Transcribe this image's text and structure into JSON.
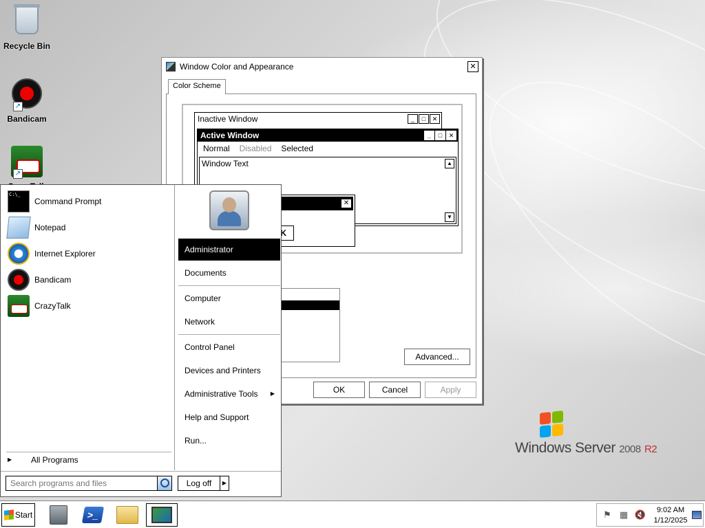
{
  "desktop": {
    "icons": [
      {
        "label": "Recycle Bin",
        "icon": "recycle-bin-icon"
      },
      {
        "label": "Bandicam",
        "icon": "bandicam-icon"
      },
      {
        "label": "CrazyTalk",
        "icon": "crazytalk-icon"
      }
    ],
    "logo": {
      "brand": "Windows Server",
      "version": "2008",
      "release": "R2"
    }
  },
  "dialog": {
    "title": "Window Color and Appearance",
    "tab": "Color Scheme",
    "preview": {
      "inactive_title": "Inactive Window",
      "active_title": "Active Window",
      "menu": {
        "normal": "Normal",
        "disabled": "Disabled",
        "selected": "Selected"
      },
      "window_text": "Window Text",
      "msgbox_ok": "OK"
    },
    "advanced_label": "Advanced...",
    "ok_label": "OK",
    "cancel_label": "Cancel",
    "apply_label": "Apply"
  },
  "start_menu": {
    "programs": [
      {
        "label": "Command Prompt",
        "icon": "command-prompt-icon"
      },
      {
        "label": "Notepad",
        "icon": "notepad-icon"
      },
      {
        "label": "Internet Explorer",
        "icon": "internet-explorer-icon"
      },
      {
        "label": "Bandicam",
        "icon": "bandicam-icon"
      },
      {
        "label": "CrazyTalk",
        "icon": "crazytalk-icon"
      }
    ],
    "all_programs": "All Programs",
    "search_placeholder": "Search programs and files",
    "logoff_label": "Log off",
    "places": [
      {
        "label": "Administrator",
        "highlighted": true
      },
      {
        "label": "Documents"
      },
      {
        "label": "Computer"
      },
      {
        "label": "Network"
      },
      {
        "label": "Control Panel"
      },
      {
        "label": "Devices and Printers"
      },
      {
        "label": "Administrative Tools",
        "has_submenu": true
      },
      {
        "label": "Help and Support"
      },
      {
        "label": "Run..."
      }
    ]
  },
  "taskbar": {
    "start_label": "Start",
    "apps": [
      "server-manager-icon",
      "powershell-icon",
      "windows-explorer-icon",
      "display-settings-icon"
    ],
    "clock": {
      "time": "9:02 AM",
      "date": "1/12/2025"
    }
  }
}
